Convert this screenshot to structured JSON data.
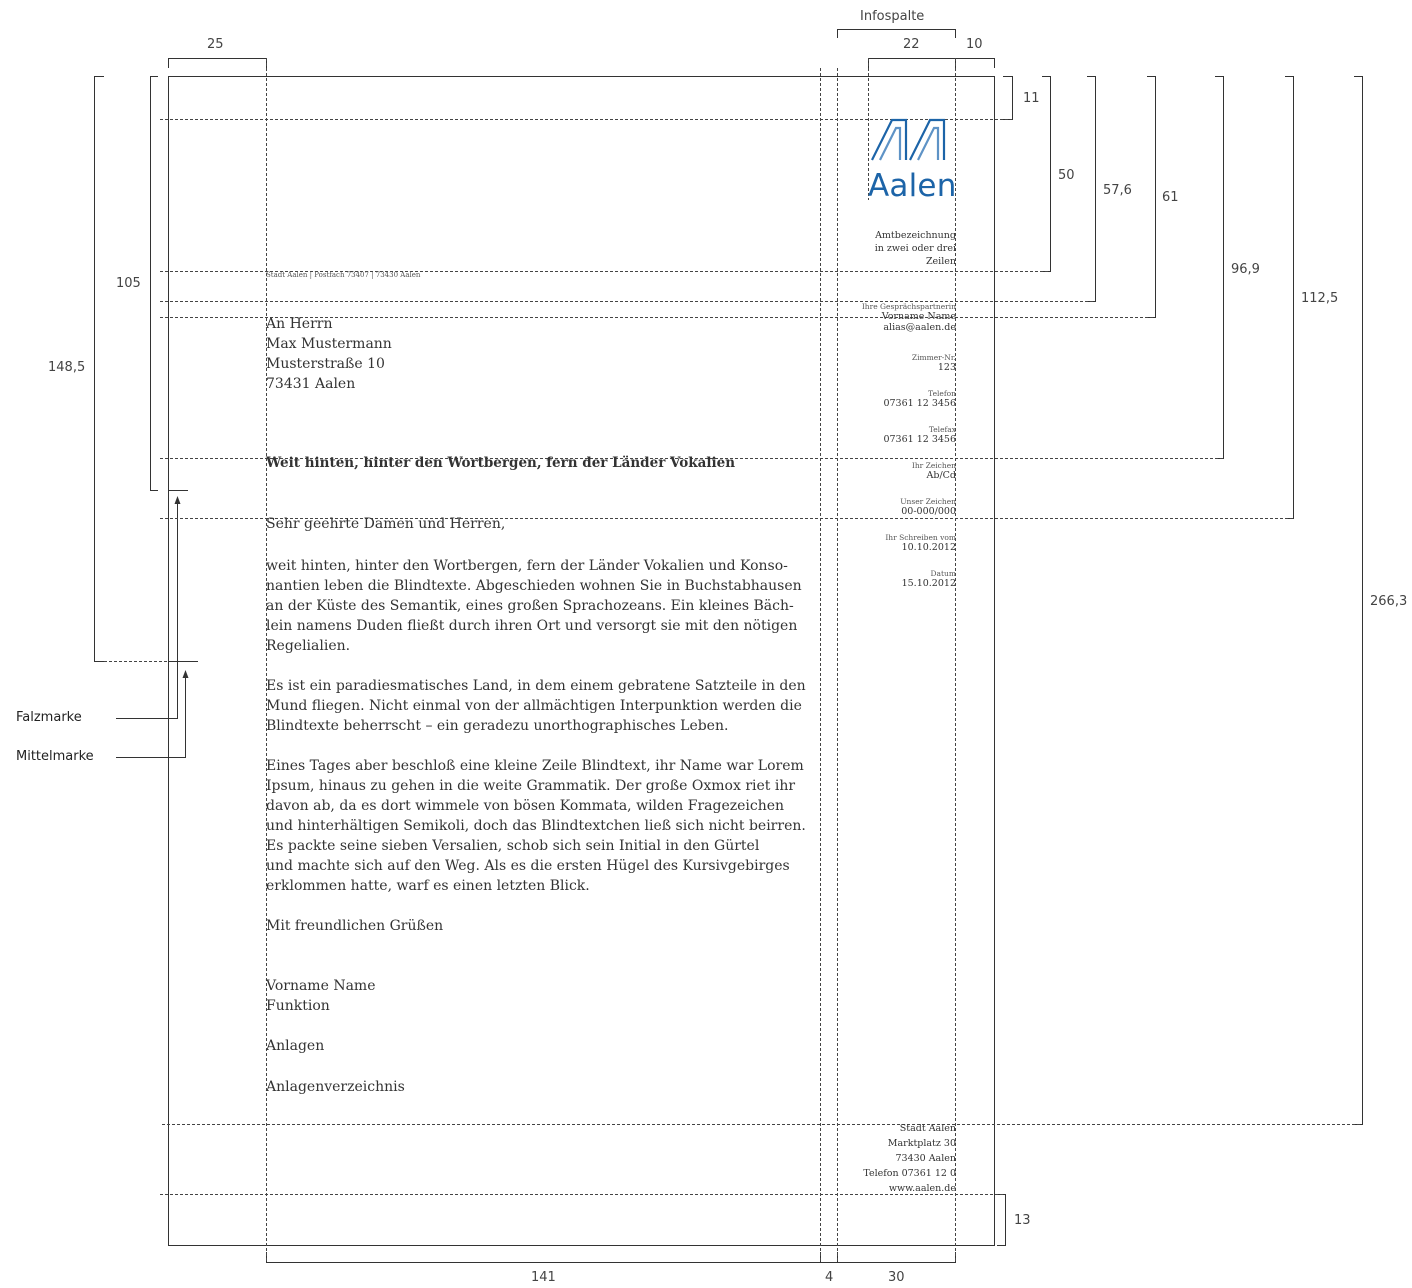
{
  "dimensions": {
    "infospalte": "Infospalte",
    "left_margin": "25",
    "info_width": "22",
    "right_margin": "10",
    "top_margin": "11",
    "sender_line": "50",
    "address_start": "57,6",
    "address_top": "61",
    "subject_line": "96,9",
    "salutation_line": "112,5",
    "fold_mark": "105",
    "mid_mark": "148,5",
    "footer_line": "266,3",
    "bottom_margin": "13",
    "text_width": "141",
    "gap": "4",
    "info_col": "30"
  },
  "marks": {
    "falzmarke": "Falzmarke",
    "mittelmarke": "Mittelmarke"
  },
  "logo": {
    "text": "Aalen",
    "color": "#1c64a8"
  },
  "letter": {
    "department": [
      "Amtbezeichnung",
      "in zwei oder drei",
      "Zeilen"
    ],
    "sender_line": "Stadt Aalen | Postfach 73407 | 73430 Aalen",
    "address": [
      "An Herrn",
      "Max Mustermann",
      "Musterstraße 10",
      "73431 Aalen"
    ],
    "subject": "Weit hinten, hinter den Wortbergen, fern der Länder Vokalien",
    "salutation": "Sehr geehrte Damen und Herren,",
    "paragraphs": [
      [
        "weit hinten, hinter den Wortbergen, fern der Länder Vokalien und Konso-",
        "nantien leben die Blindtexte. Abgeschieden wohnen Sie in Buchstabhausen",
        "an der Küste des Semantik, eines großen Sprachozeans. Ein kleines Bäch-",
        "lein namens Duden fließt durch ihren Ort und versorgt sie mit den nötigen",
        "Regelialien."
      ],
      [
        "Es ist ein paradiesmatisches Land, in dem einem gebratene Satzteile in den",
        "Mund fliegen. Nicht einmal von der allmächtigen Interpunktion werden die",
        "Blindtexte beherrscht – ein geradezu unorthographisches Leben."
      ],
      [
        "Eines Tages aber beschloß eine kleine Zeile Blindtext, ihr Name war Lorem",
        "Ipsum, hinaus zu gehen in die weite Grammatik. Der große Oxmox riet ihr",
        "davon ab, da es dort wimmele von bösen Kommata, wilden Fragezeichen",
        "und hinterhältigen Semikoli, doch das Blindtextchen ließ sich nicht beirren.",
        "Es packte seine sieben Versalien, schob sich sein Initial in den Gürtel",
        "und machte sich auf den Weg. Als es die ersten Hügel des Kursivgebirges",
        "erklommen hatte, warf es einen letzten Blick."
      ]
    ],
    "closing": "Mit freundlichen Grüßen",
    "signature_name": "Vorname Name",
    "signature_function": "Funktion",
    "attachments": "Anlagen",
    "attachments_list": "Anlagenverzeichnis"
  },
  "info_column": [
    {
      "label": "Ihre Gesprächspartnerin",
      "values": [
        "Vorname Name",
        "alias@aalen.de"
      ]
    },
    {
      "label": "Zimmer-Nr.",
      "values": [
        "123"
      ]
    },
    {
      "label": "Telefon",
      "values": [
        "07361 12 3456"
      ]
    },
    {
      "label": "Telefax",
      "values": [
        "07361 12 3456"
      ]
    },
    {
      "label": "Ihr Zeichen",
      "values": [
        "Ab/Cd"
      ]
    },
    {
      "label": "Unser Zeichen",
      "values": [
        "00-000/000"
      ]
    },
    {
      "label": "Ihr Schreiben vom",
      "values": [
        "10.10.2012"
      ]
    },
    {
      "label": "Datum",
      "values": [
        "15.10.2012"
      ]
    }
  ],
  "footer": [
    "Stadt Aalen",
    "Marktplatz 30",
    "73430 Aalen",
    "Telefon 07361 12 0",
    "www.aalen.de"
  ]
}
